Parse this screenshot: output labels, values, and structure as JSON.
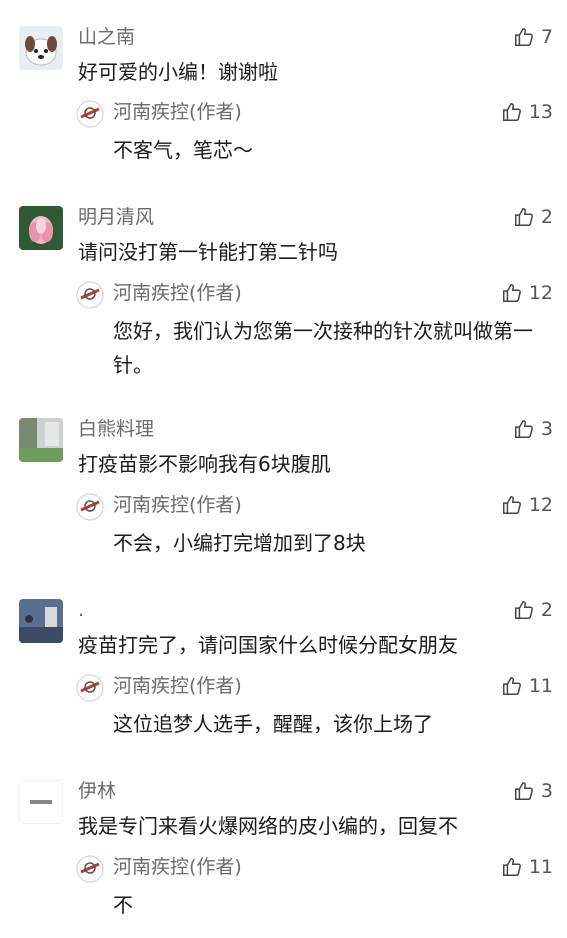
{
  "comments": [
    {
      "name": "山之南",
      "likes": "7",
      "text": "好可爱的小编！谢谢啦",
      "reply": {
        "name": "河南疾控(作者)",
        "likes": "13",
        "text": "不客气，笔芯～"
      }
    },
    {
      "name": "明月清风",
      "likes": "2",
      "text": "请问没打第一针能打第二针吗",
      "reply": {
        "name": "河南疾控(作者)",
        "likes": "12",
        "text": "您好，我们认为您第一次接种的针次就叫做第一针。"
      }
    },
    {
      "name": "白熊料理",
      "likes": "3",
      "text": "打疫苗影不影响我有6块腹肌",
      "reply": {
        "name": "河南疾控(作者)",
        "likes": "12",
        "text": "不会，小编打完增加到了8块"
      }
    },
    {
      "name": ".",
      "likes": "2",
      "text": "疫苗打完了，请问国家什么时候分配女朋友",
      "reply": {
        "name": "河南疾控(作者)",
        "likes": "11",
        "text": "这位追梦人选手，醒醒，该你上场了"
      }
    },
    {
      "name": "伊林",
      "likes": "3",
      "text": "我是专门来看火爆网络的皮小编的，回复不",
      "reply": {
        "name": "河南疾控(作者)",
        "likes": "11",
        "text": "不"
      }
    }
  ]
}
